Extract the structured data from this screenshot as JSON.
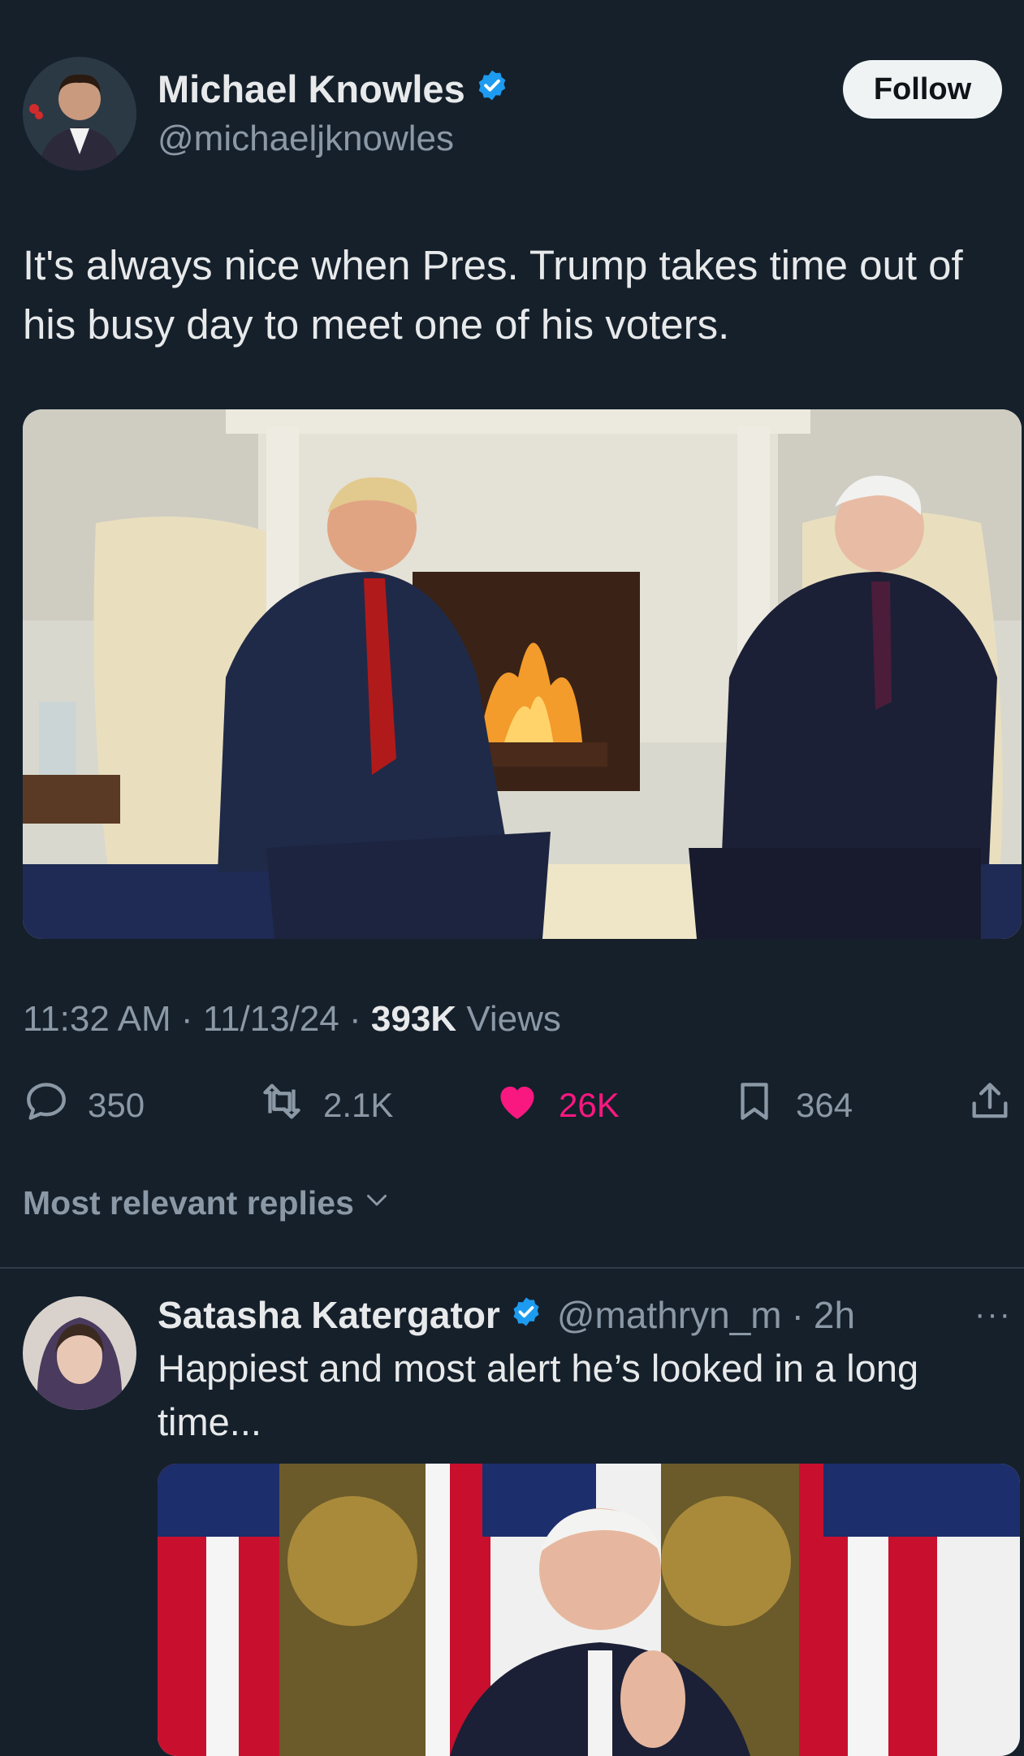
{
  "author": {
    "name": "Michael Knowles",
    "handle": "@michaeljknowles",
    "verified_color": "#1d9bf0"
  },
  "follow_label": "Follow",
  "post": {
    "text": "It's always nice when Pres. Trump takes time out of his busy day to meet one of his voters.",
    "time": "11:32 AM",
    "date": "11/13/24",
    "views_count": "393K",
    "views_label": "Views",
    "sep": "·"
  },
  "actions": {
    "replies": "350",
    "reposts": "2.1K",
    "likes": "26K",
    "bookmarks": "364"
  },
  "replies_filter": "Most relevant replies",
  "reply": {
    "name": "Satasha Katergator",
    "handle": "@mathryn_m",
    "age": "2h",
    "text": "Happiest and most alert he’s looked in a long time...",
    "more": "···"
  },
  "colors": {
    "background": "#15202b",
    "like": "#f91880",
    "muted": "#8b98a5"
  }
}
